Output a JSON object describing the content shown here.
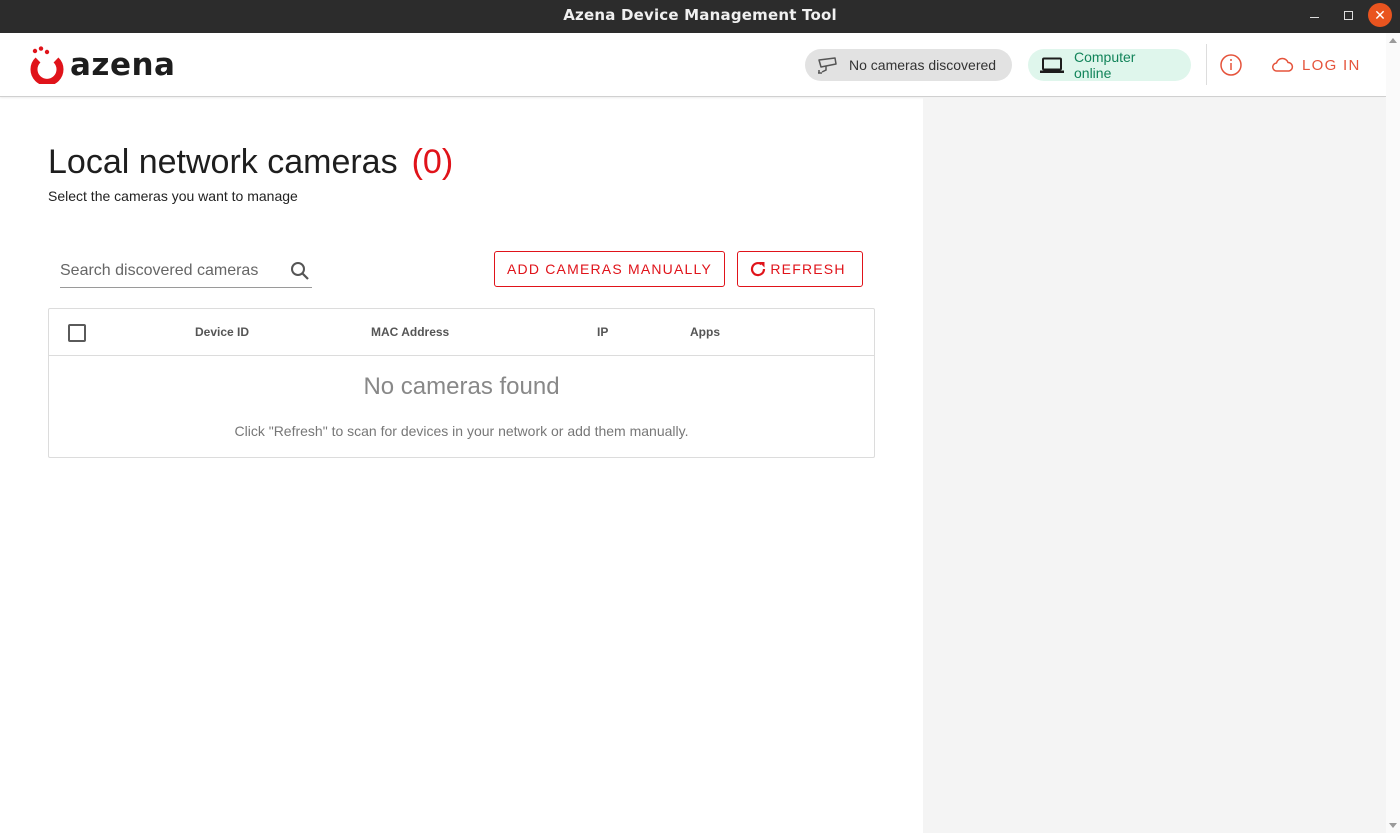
{
  "window": {
    "title": "Azena Device Management Tool"
  },
  "header": {
    "logo_text": "azena",
    "cameras_status": "No cameras discovered",
    "computer_status": "Computer online",
    "login_label": "LOG IN"
  },
  "main": {
    "title": "Local network cameras",
    "count": "(0)",
    "subtitle": "Select the cameras you want to manage",
    "search": {
      "placeholder": "Search discovered cameras",
      "value": ""
    },
    "add_button": "ADD CAMERAS MANUALLY",
    "refresh_button": "REFRESH",
    "table": {
      "columns": [
        "Device ID",
        "MAC Address",
        "IP",
        "Apps"
      ],
      "empty_title": "No cameras found",
      "empty_hint": "Click \"Refresh\" to scan for devices in your network or add them manually."
    }
  },
  "colors": {
    "accent": "#e0131a",
    "login": "#e5533b",
    "online_bg": "#dff6ec",
    "online_text": "#12845a",
    "titlebar": "#2c2c2c",
    "side_panel": "#f4f4f4"
  },
  "icons": {
    "logo": "azena-logo-icon",
    "camera_status": "camera-icon",
    "computer_status": "laptop-icon",
    "info": "info-icon",
    "login": "cloud-icon",
    "search": "search-icon",
    "refresh": "refresh-icon"
  }
}
